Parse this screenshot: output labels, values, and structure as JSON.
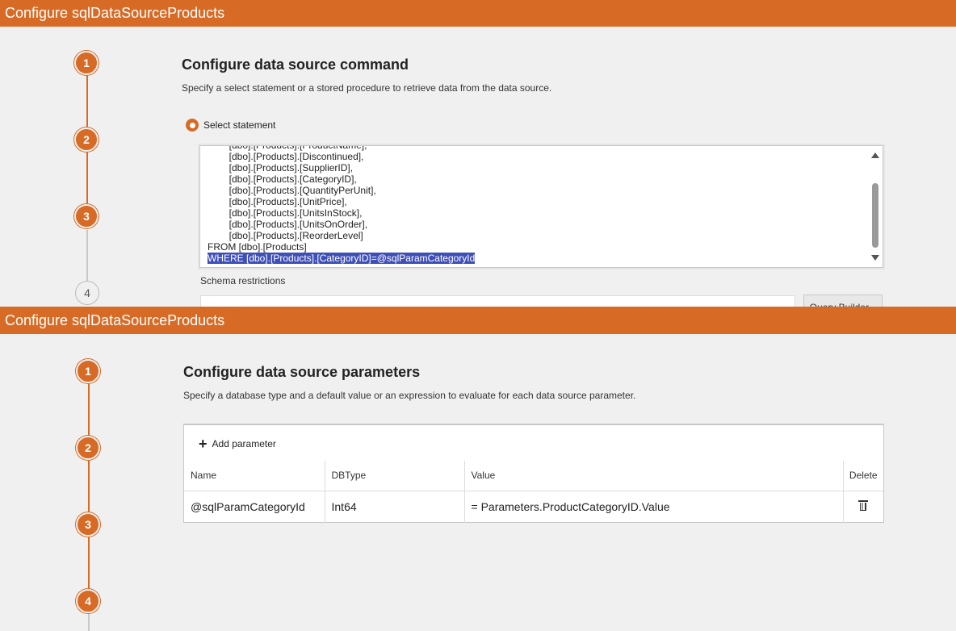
{
  "panel1": {
    "header": "Configure sqlDataSourceProducts",
    "steps": [
      "1",
      "2",
      "3",
      "4"
    ],
    "title": "Configure data source command",
    "subtitle": "Specify a select statement or a stored procedure to retrieve data from the data source.",
    "radio_label": "Select statement",
    "sql_lines": [
      "        [dbo].[Products].[ProductName],",
      "        [dbo].[Products].[Discontinued],",
      "        [dbo].[Products].[SupplierID],",
      "        [dbo].[Products].[CategoryID],",
      "        [dbo].[Products].[QuantityPerUnit],",
      "        [dbo].[Products].[UnitPrice],",
      "        [dbo].[Products].[UnitsInStock],",
      "        [dbo].[Products].[UnitsOnOrder],",
      "        [dbo].[Products].[ReorderLevel]",
      "FROM [dbo].[Products]"
    ],
    "sql_selected_line": "WHERE [dbo].[Products].[CategoryID]=@sqlParamCategoryId",
    "schema_label": "Schema restrictions",
    "query_builder_label": "Query Builder..."
  },
  "panel2": {
    "header": "Configure sqlDataSourceProducts",
    "steps": [
      "1",
      "2",
      "3",
      "4"
    ],
    "title": "Configure data source parameters",
    "subtitle": "Specify a database type and a default value or an expression to evaluate for each data source parameter.",
    "add_parameter_label": "Add parameter",
    "columns": [
      "Name",
      "DBType",
      "Value",
      "Delete"
    ],
    "rows": [
      {
        "name": "@sqlParamCategoryId",
        "dbtype": "Int64",
        "value": "= Parameters.ProductCategoryID.Value"
      }
    ]
  },
  "colors": {
    "accent": "#d76b26",
    "selection": "#3f4fb8"
  }
}
